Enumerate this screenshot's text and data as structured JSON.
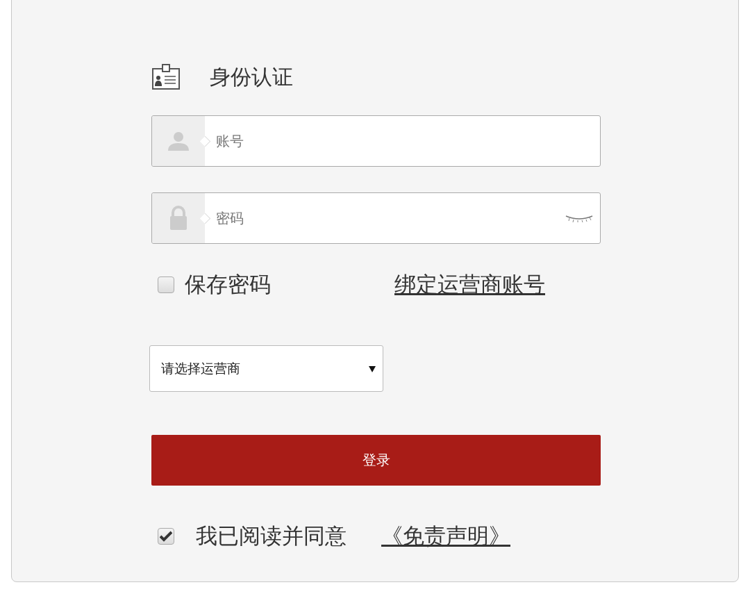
{
  "title": "身份认证",
  "fields": [
    {
      "kind": "account",
      "placeholder": "账号"
    },
    {
      "kind": "password",
      "placeholder": "密码"
    }
  ],
  "save_password": {
    "label": "保存密码",
    "checked": false
  },
  "bind_link": "绑定运营商账号",
  "carrier_select": {
    "value": "请选择运营商"
  },
  "login_button": "登录",
  "agree": {
    "label": "我已阅读并同意",
    "checked": true,
    "link": "《免责声明》"
  }
}
